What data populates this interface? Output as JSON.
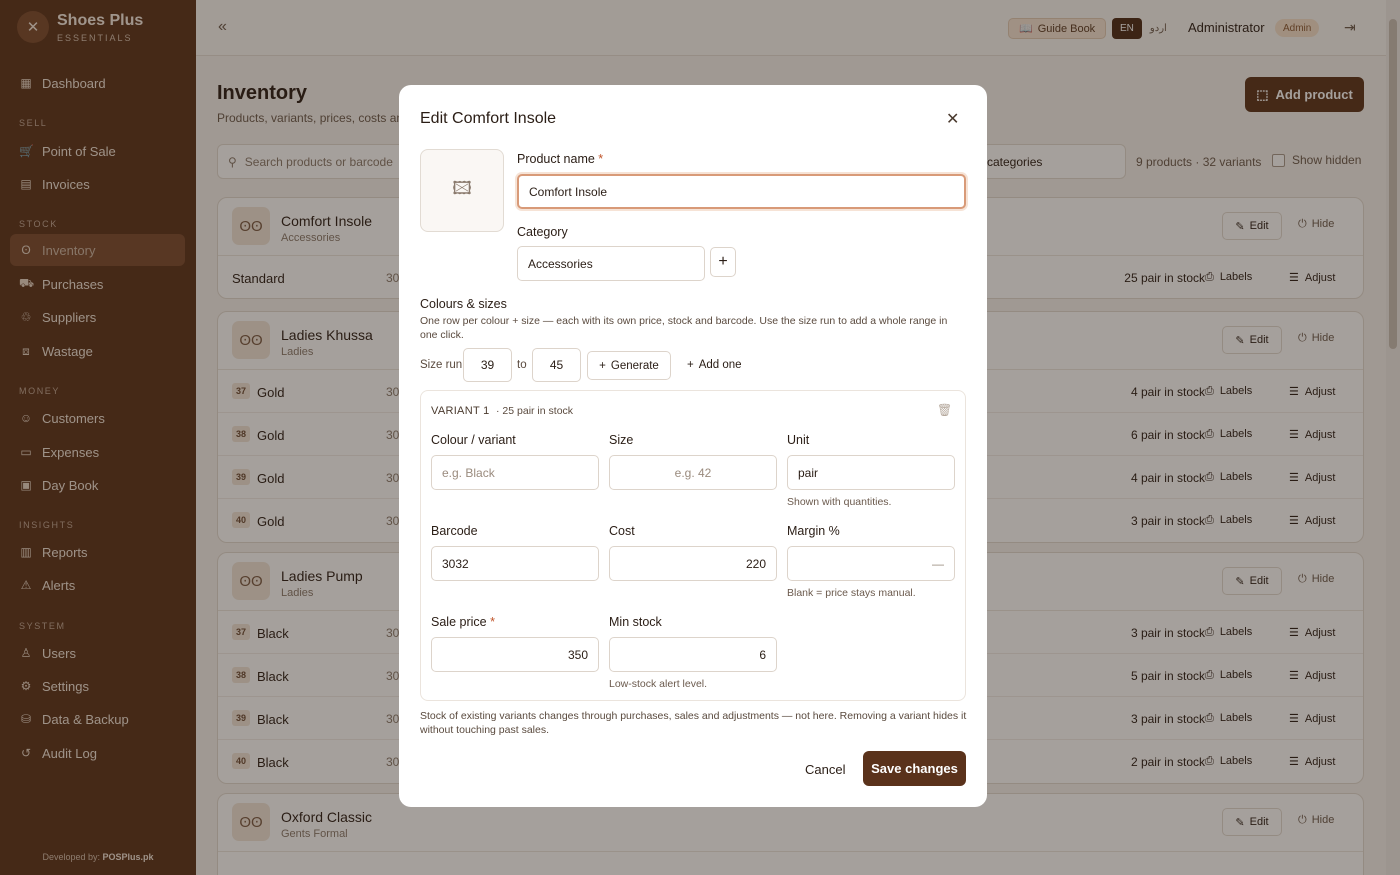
{
  "brand": {
    "name": "Shoes Plus",
    "sub": "ESSENTIALS"
  },
  "sidebar": {
    "sections": {
      "sell": "SELL",
      "stock": "STOCK",
      "money": "MONEY",
      "insights": "INSIGHTS",
      "system": "SYSTEM"
    },
    "items": {
      "dashboard": "Dashboard",
      "pos": "Point of Sale",
      "invoices": "Invoices",
      "inventory": "Inventory",
      "purchases": "Purchases",
      "suppliers": "Suppliers",
      "wastage": "Wastage",
      "customers": "Customers",
      "expenses": "Expenses",
      "daybook": "Day Book",
      "reports": "Reports",
      "alerts": "Alerts",
      "users": "Users",
      "settings": "Settings",
      "backup": "Data & Backup",
      "audit": "Audit Log"
    },
    "active": "Inventory",
    "dev_prefix": "Developed by:",
    "dev_brand": "POSPlus.pk"
  },
  "topbar": {
    "guide": "Guide Book",
    "lang_en": "EN",
    "lang_ur": "اردو",
    "user": "Administrator",
    "role": "Admin"
  },
  "page": {
    "title": "Inventory",
    "subtitle": "Products, variants, prices, costs an",
    "add_product": "Add product",
    "search_placeholder": "Search products or barcode",
    "category_filter": "categories",
    "counts": "9 products · 32 variants",
    "show_hidden": "Show hidden"
  },
  "actions": {
    "edit": "Edit",
    "hide": "Hide",
    "labels": "Labels",
    "adjust": "Adjust"
  },
  "products": [
    {
      "name": "Comfort Insole",
      "category": "Accessories",
      "variants": [
        {
          "size": "",
          "name": "Standard",
          "code": "30",
          "stock": "25 pair in stock"
        }
      ]
    },
    {
      "name": "Ladies Khussa",
      "category": "Ladies",
      "variants": [
        {
          "size": "37",
          "name": "Gold",
          "code": "30",
          "stock": "4 pair in stock"
        },
        {
          "size": "38",
          "name": "Gold",
          "code": "30",
          "stock": "6 pair in stock"
        },
        {
          "size": "39",
          "name": "Gold",
          "code": "30",
          "stock": "4 pair in stock"
        },
        {
          "size": "40",
          "name": "Gold",
          "code": "30",
          "stock": "3 pair in stock"
        }
      ]
    },
    {
      "name": "Ladies Pump",
      "category": "Ladies",
      "variants": [
        {
          "size": "37",
          "name": "Black",
          "code": "30",
          "stock": "3 pair in stock"
        },
        {
          "size": "38",
          "name": "Black",
          "code": "30",
          "stock": "5 pair in stock"
        },
        {
          "size": "39",
          "name": "Black",
          "code": "30",
          "stock": "3 pair in stock"
        },
        {
          "size": "40",
          "name": "Black",
          "code": "30",
          "stock": "2 pair in stock"
        }
      ]
    },
    {
      "name": "Oxford Classic",
      "category": "Gents Formal",
      "variants": []
    }
  ],
  "modal": {
    "title": "Edit Comfort Insole",
    "product_name_label": "Product name",
    "product_name_value": "Comfort Insole",
    "category_label": "Category",
    "category_value": "Accessories",
    "section_title": "Colours & sizes",
    "section_help": "One row per colour + size — each with its own price, stock and barcode. Use the size run to add a whole range in one click.",
    "size_run_label": "Size run",
    "size_from": "39",
    "size_to_label": "to",
    "size_to": "45",
    "generate": "Generate",
    "add_one": "Add one",
    "variant_title": "VARIANT 1",
    "variant_stock": "· 25 pair in stock",
    "colour_label": "Colour / variant",
    "colour_placeholder": "e.g. Black",
    "size_label": "Size",
    "size_placeholder": "e.g. 42",
    "unit_label": "Unit",
    "unit_value": "pair",
    "unit_hint": "Shown with quantities.",
    "barcode_label": "Barcode",
    "barcode_value": "3032",
    "cost_label": "Cost",
    "cost_value": "220",
    "margin_label": "Margin %",
    "margin_placeholder": "—",
    "margin_hint": "Blank = price stays manual.",
    "sale_label": "Sale price",
    "sale_value": "350",
    "min_label": "Min stock",
    "min_value": "6",
    "min_hint": "Low-stock alert level.",
    "note": "Stock of existing variants changes through purchases, sales and adjustments — not here. Removing a variant hides it without touching past sales.",
    "cancel": "Cancel",
    "save": "Save changes"
  }
}
